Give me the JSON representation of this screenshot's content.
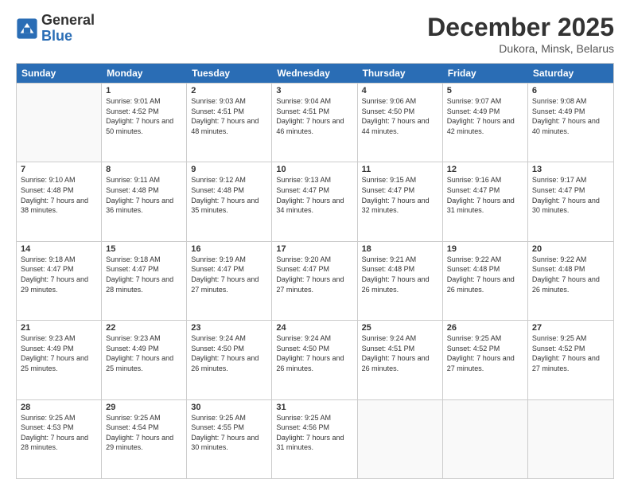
{
  "logo": {
    "general": "General",
    "blue": "Blue"
  },
  "header": {
    "month": "December 2025",
    "location": "Dukora, Minsk, Belarus"
  },
  "weekdays": [
    "Sunday",
    "Monday",
    "Tuesday",
    "Wednesday",
    "Thursday",
    "Friday",
    "Saturday"
  ],
  "weeks": [
    [
      {
        "day": "",
        "sunrise": "",
        "sunset": "",
        "daylight": ""
      },
      {
        "day": "1",
        "sunrise": "Sunrise: 9:01 AM",
        "sunset": "Sunset: 4:52 PM",
        "daylight": "Daylight: 7 hours and 50 minutes."
      },
      {
        "day": "2",
        "sunrise": "Sunrise: 9:03 AM",
        "sunset": "Sunset: 4:51 PM",
        "daylight": "Daylight: 7 hours and 48 minutes."
      },
      {
        "day": "3",
        "sunrise": "Sunrise: 9:04 AM",
        "sunset": "Sunset: 4:51 PM",
        "daylight": "Daylight: 7 hours and 46 minutes."
      },
      {
        "day": "4",
        "sunrise": "Sunrise: 9:06 AM",
        "sunset": "Sunset: 4:50 PM",
        "daylight": "Daylight: 7 hours and 44 minutes."
      },
      {
        "day": "5",
        "sunrise": "Sunrise: 9:07 AM",
        "sunset": "Sunset: 4:49 PM",
        "daylight": "Daylight: 7 hours and 42 minutes."
      },
      {
        "day": "6",
        "sunrise": "Sunrise: 9:08 AM",
        "sunset": "Sunset: 4:49 PM",
        "daylight": "Daylight: 7 hours and 40 minutes."
      }
    ],
    [
      {
        "day": "7",
        "sunrise": "Sunrise: 9:10 AM",
        "sunset": "Sunset: 4:48 PM",
        "daylight": "Daylight: 7 hours and 38 minutes."
      },
      {
        "day": "8",
        "sunrise": "Sunrise: 9:11 AM",
        "sunset": "Sunset: 4:48 PM",
        "daylight": "Daylight: 7 hours and 36 minutes."
      },
      {
        "day": "9",
        "sunrise": "Sunrise: 9:12 AM",
        "sunset": "Sunset: 4:48 PM",
        "daylight": "Daylight: 7 hours and 35 minutes."
      },
      {
        "day": "10",
        "sunrise": "Sunrise: 9:13 AM",
        "sunset": "Sunset: 4:47 PM",
        "daylight": "Daylight: 7 hours and 34 minutes."
      },
      {
        "day": "11",
        "sunrise": "Sunrise: 9:15 AM",
        "sunset": "Sunset: 4:47 PM",
        "daylight": "Daylight: 7 hours and 32 minutes."
      },
      {
        "day": "12",
        "sunrise": "Sunrise: 9:16 AM",
        "sunset": "Sunset: 4:47 PM",
        "daylight": "Daylight: 7 hours and 31 minutes."
      },
      {
        "day": "13",
        "sunrise": "Sunrise: 9:17 AM",
        "sunset": "Sunset: 4:47 PM",
        "daylight": "Daylight: 7 hours and 30 minutes."
      }
    ],
    [
      {
        "day": "14",
        "sunrise": "Sunrise: 9:18 AM",
        "sunset": "Sunset: 4:47 PM",
        "daylight": "Daylight: 7 hours and 29 minutes."
      },
      {
        "day": "15",
        "sunrise": "Sunrise: 9:18 AM",
        "sunset": "Sunset: 4:47 PM",
        "daylight": "Daylight: 7 hours and 28 minutes."
      },
      {
        "day": "16",
        "sunrise": "Sunrise: 9:19 AM",
        "sunset": "Sunset: 4:47 PM",
        "daylight": "Daylight: 7 hours and 27 minutes."
      },
      {
        "day": "17",
        "sunrise": "Sunrise: 9:20 AM",
        "sunset": "Sunset: 4:47 PM",
        "daylight": "Daylight: 7 hours and 27 minutes."
      },
      {
        "day": "18",
        "sunrise": "Sunrise: 9:21 AM",
        "sunset": "Sunset: 4:48 PM",
        "daylight": "Daylight: 7 hours and 26 minutes."
      },
      {
        "day": "19",
        "sunrise": "Sunrise: 9:22 AM",
        "sunset": "Sunset: 4:48 PM",
        "daylight": "Daylight: 7 hours and 26 minutes."
      },
      {
        "day": "20",
        "sunrise": "Sunrise: 9:22 AM",
        "sunset": "Sunset: 4:48 PM",
        "daylight": "Daylight: 7 hours and 26 minutes."
      }
    ],
    [
      {
        "day": "21",
        "sunrise": "Sunrise: 9:23 AM",
        "sunset": "Sunset: 4:49 PM",
        "daylight": "Daylight: 7 hours and 25 minutes."
      },
      {
        "day": "22",
        "sunrise": "Sunrise: 9:23 AM",
        "sunset": "Sunset: 4:49 PM",
        "daylight": "Daylight: 7 hours and 25 minutes."
      },
      {
        "day": "23",
        "sunrise": "Sunrise: 9:24 AM",
        "sunset": "Sunset: 4:50 PM",
        "daylight": "Daylight: 7 hours and 26 minutes."
      },
      {
        "day": "24",
        "sunrise": "Sunrise: 9:24 AM",
        "sunset": "Sunset: 4:50 PM",
        "daylight": "Daylight: 7 hours and 26 minutes."
      },
      {
        "day": "25",
        "sunrise": "Sunrise: 9:24 AM",
        "sunset": "Sunset: 4:51 PM",
        "daylight": "Daylight: 7 hours and 26 minutes."
      },
      {
        "day": "26",
        "sunrise": "Sunrise: 9:25 AM",
        "sunset": "Sunset: 4:52 PM",
        "daylight": "Daylight: 7 hours and 27 minutes."
      },
      {
        "day": "27",
        "sunrise": "Sunrise: 9:25 AM",
        "sunset": "Sunset: 4:52 PM",
        "daylight": "Daylight: 7 hours and 27 minutes."
      }
    ],
    [
      {
        "day": "28",
        "sunrise": "Sunrise: 9:25 AM",
        "sunset": "Sunset: 4:53 PM",
        "daylight": "Daylight: 7 hours and 28 minutes."
      },
      {
        "day": "29",
        "sunrise": "Sunrise: 9:25 AM",
        "sunset": "Sunset: 4:54 PM",
        "daylight": "Daylight: 7 hours and 29 minutes."
      },
      {
        "day": "30",
        "sunrise": "Sunrise: 9:25 AM",
        "sunset": "Sunset: 4:55 PM",
        "daylight": "Daylight: 7 hours and 30 minutes."
      },
      {
        "day": "31",
        "sunrise": "Sunrise: 9:25 AM",
        "sunset": "Sunset: 4:56 PM",
        "daylight": "Daylight: 7 hours and 31 minutes."
      },
      {
        "day": "",
        "sunrise": "",
        "sunset": "",
        "daylight": ""
      },
      {
        "day": "",
        "sunrise": "",
        "sunset": "",
        "daylight": ""
      },
      {
        "day": "",
        "sunrise": "",
        "sunset": "",
        "daylight": ""
      }
    ]
  ]
}
